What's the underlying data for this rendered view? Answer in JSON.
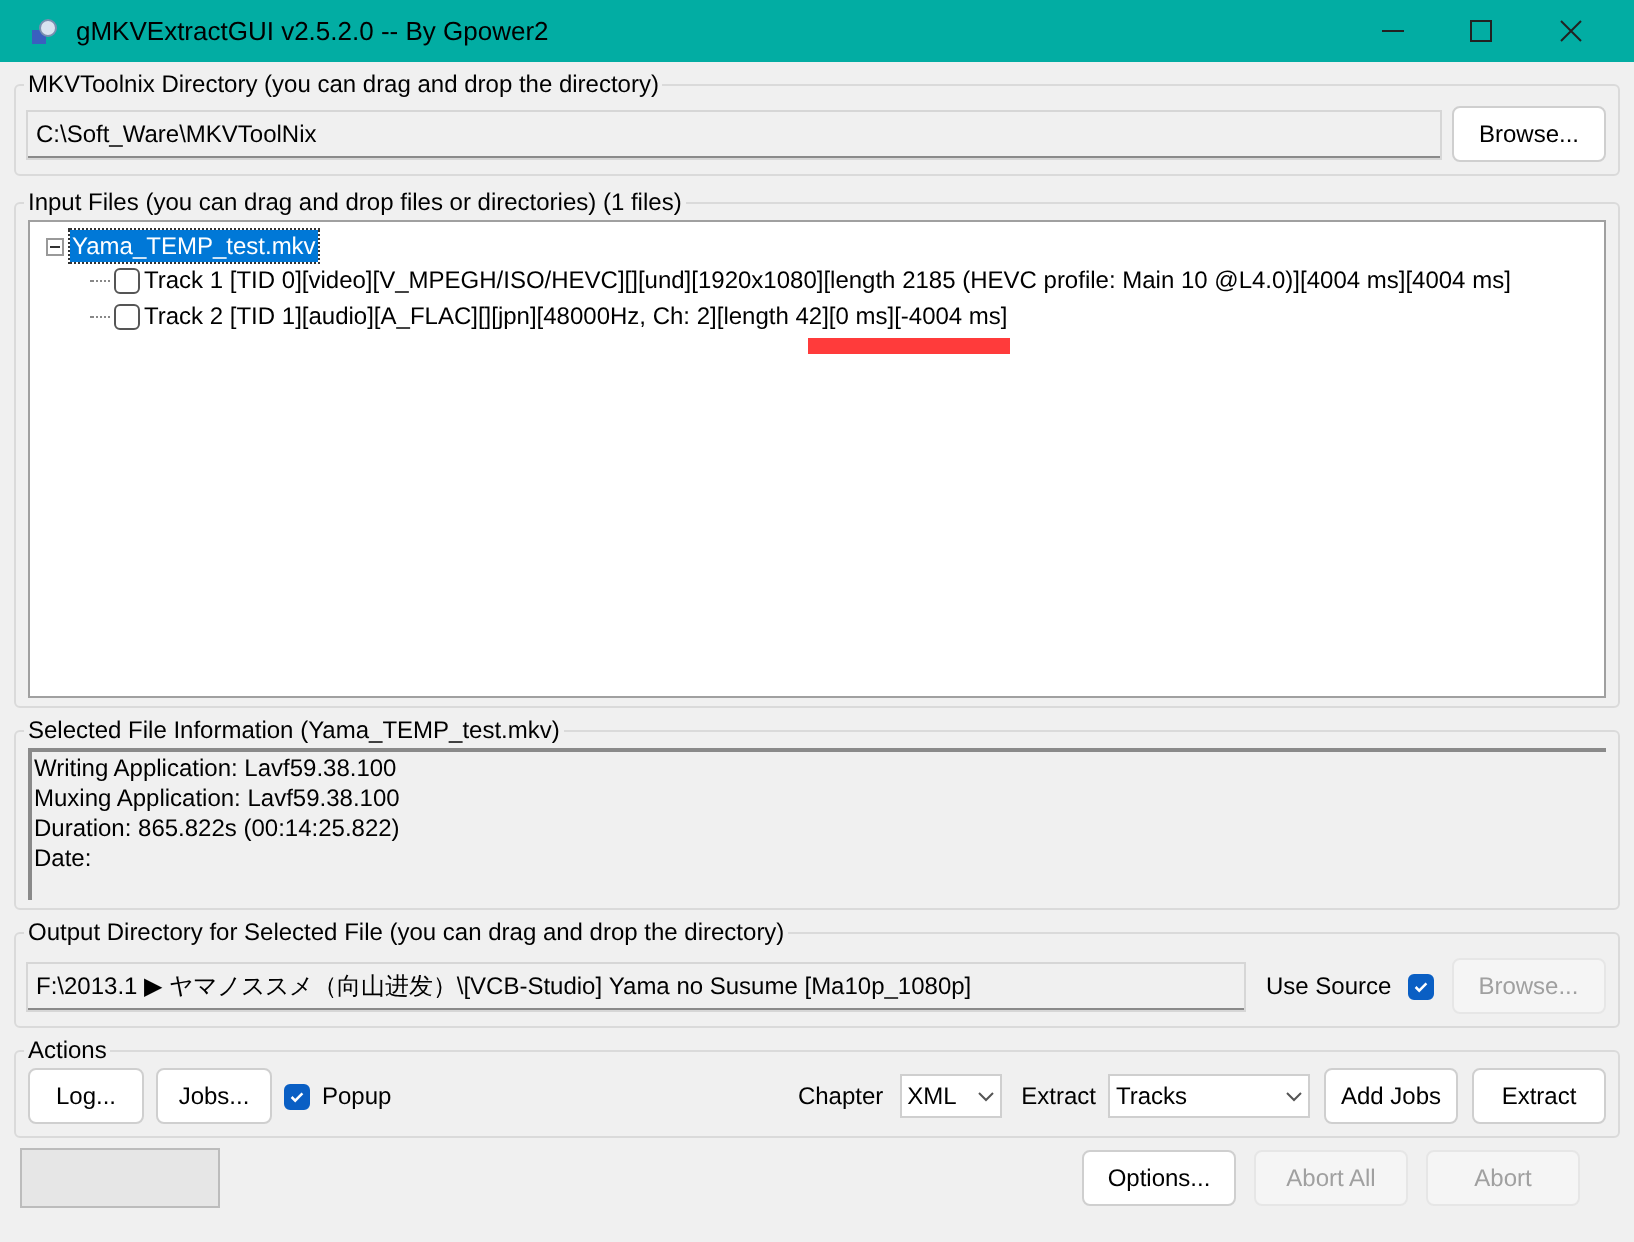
{
  "window": {
    "title": "gMKVExtractGUI v2.5.2.0 -- By Gpower2"
  },
  "mkvtoolnix": {
    "label": "MKVToolnix Directory (you can drag and drop the directory)",
    "path": "C:\\Soft_Ware\\MKVToolNix",
    "browse": {
      "label": "Browse...",
      "disabled": false
    }
  },
  "input_files": {
    "label": "Input Files (you can drag and drop files or directories) (1 files)",
    "tree": [
      {
        "label": "Yama_TEMP_test.mkv",
        "selected": true,
        "expanded": true,
        "children": [
          {
            "label": "Track 1 [TID 0][video][V_MPEGH/ISO/HEVC][][und][1920x1080][length 2185 (HEVC profile: Main 10 @L4.0)][4004 ms][4004 ms]",
            "checked": false
          },
          {
            "label": "Track 2 [TID 1][audio][A_FLAC][][jpn][48000Hz, Ch: 2][length 42][0 ms][-4004 ms]",
            "checked": false
          }
        ]
      }
    ]
  },
  "file_info": {
    "label": "Selected File Information (Yama_TEMP_test.mkv)",
    "lines": [
      "Writing Application: Lavf59.38.100",
      "Muxing Application: Lavf59.38.100",
      "Duration: 865.822s (00:14:25.822)",
      "Date:"
    ]
  },
  "output": {
    "label": "Output Directory for Selected File (you can drag and drop the directory)",
    "path": "F:\\2013.1 ▶ ヤマノススメ（向山进发）\\[VCB-Studio] Yama no Susume [Ma10p_1080p]",
    "use_source_label": "Use Source",
    "use_source": true,
    "browse": {
      "label": "Browse...",
      "disabled": true
    }
  },
  "actions": {
    "label": "Actions",
    "log": "Log...",
    "jobs": "Jobs...",
    "popup_label": "Popup",
    "popup": true,
    "chapter_label": "Chapter",
    "chapter_value": "XML",
    "extract_label": "Extract",
    "extract_value": "Tracks",
    "add_jobs": "Add Jobs",
    "extract": "Extract"
  },
  "status_bar": {
    "buttons": [
      {
        "label": "Options...",
        "disabled": false
      },
      {
        "label": "Abort All",
        "disabled": true
      },
      {
        "label": "Abort",
        "disabled": true
      }
    ]
  }
}
